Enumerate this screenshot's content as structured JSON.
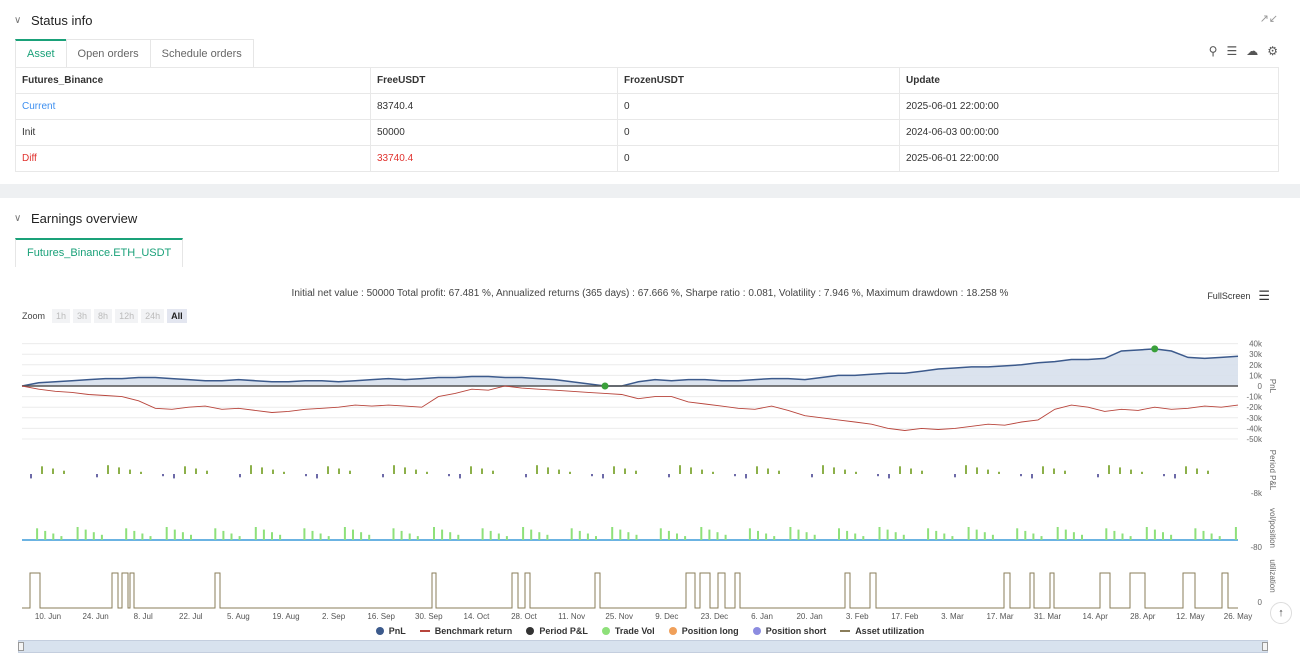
{
  "status": {
    "title": "Status info",
    "tabs": [
      "Asset",
      "Open orders",
      "Schedule orders"
    ],
    "table": {
      "headers": [
        "Futures_Binance",
        "FreeUSDT",
        "FrozenUSDT",
        "Update"
      ],
      "rows": [
        [
          "Current",
          "83740.4",
          "0",
          "2025-06-01 22:00:00"
        ],
        [
          "Init",
          "50000",
          "0",
          "2024-06-03 00:00:00"
        ],
        [
          "Diff",
          "33740.4",
          "0",
          "2025-06-01 22:00:00"
        ]
      ]
    }
  },
  "earnings": {
    "title": "Earnings overview",
    "tab": "Futures_Binance.ETH_USDT",
    "summary": "Initial net value : 50000 Total profit: 67.481 %, Annualized returns (365 days) : 67.666 %, Sharpe ratio : 0.081, Volatility : 7.946 %, Maximum drawdown : 18.258 %",
    "fullscreen": "FullScreen",
    "zoom_label": "Zoom",
    "zoom_options": [
      "1h",
      "3h",
      "8h",
      "12h",
      "24h",
      "All"
    ],
    "zoom_selected": "All"
  },
  "chart_data": {
    "type": "line",
    "x_ticks": [
      "10. Jun",
      "24. Jun",
      "8. Jul",
      "22. Jul",
      "5. Aug",
      "19. Aug",
      "2. Sep",
      "16. Sep",
      "30. Sep",
      "14. Oct",
      "28. Oct",
      "11. Nov",
      "25. Nov",
      "9. Dec",
      "23. Dec",
      "6. Jan",
      "20. Jan",
      "3. Feb",
      "17. Feb",
      "3. Mar",
      "17. Mar",
      "31. Mar",
      "14. Apr",
      "28. Apr",
      "12. May",
      "26. May"
    ],
    "pnl_axis": {
      "label": "PnL",
      "ticks": [
        "40k",
        "30k",
        "20k",
        "10k",
        "0",
        "-10k",
        "-20k",
        "-30k",
        "-40k",
        "-50k"
      ]
    },
    "period_axis": {
      "label": "Period P&L",
      "ticks": [
        "-8k"
      ]
    },
    "vol_axis": {
      "label": "vol/position",
      "ticks": [
        "-80"
      ]
    },
    "util_axis": {
      "label": "utilization",
      "ticks": [
        "0"
      ]
    },
    "series": [
      {
        "name": "PnL",
        "color": "#3c5a8c"
      },
      {
        "name": "Benchmark return",
        "color": "#b8453c"
      },
      {
        "name": "Period P&L",
        "color": "#333333"
      },
      {
        "name": "Trade Vol",
        "color": "#8ee07a"
      },
      {
        "name": "Position long",
        "color": "#f0a05a"
      },
      {
        "name": "Position short",
        "color": "#8c8ce0"
      },
      {
        "name": "Asset utilization",
        "color": "#8a7d5a"
      }
    ],
    "pnl": [
      0,
      3,
      4,
      5,
      6,
      7,
      7,
      8,
      8,
      7,
      6,
      5,
      5,
      6,
      5,
      4,
      4,
      5,
      5,
      4,
      5,
      6,
      7,
      6,
      7,
      8,
      8,
      9,
      9,
      8,
      8,
      7,
      6,
      4,
      2,
      0,
      0,
      4,
      6,
      5,
      6,
      6,
      5,
      5,
      6,
      7,
      7,
      6,
      8,
      10,
      10,
      11,
      12,
      12,
      14,
      16,
      17,
      18,
      18,
      19,
      20,
      22,
      23,
      25,
      25,
      26,
      33,
      34,
      35,
      33,
      27,
      26,
      27,
      28
    ],
    "benchmark": [
      0,
      -3,
      -5,
      -6,
      -8,
      -9,
      -10,
      -14,
      -21,
      -22,
      -20,
      -19,
      -22,
      -21,
      -23,
      -25,
      -24,
      -22,
      -21,
      -20,
      -18,
      -19,
      -18,
      -19,
      -20,
      -10,
      -7,
      -3,
      -4,
      0,
      -2,
      -3,
      -4,
      -5,
      -6,
      -7,
      -8,
      -12,
      -10,
      -10,
      -15,
      -17,
      -19,
      -21,
      -22,
      -19,
      -23,
      -28,
      -30,
      -32,
      -34,
      -36,
      -40,
      -42,
      -40,
      -41,
      -40,
      -38,
      -36,
      -37,
      -34,
      -32,
      -22,
      -18,
      -20,
      -24,
      -22,
      -23,
      -20,
      -22,
      -21,
      -19,
      -20,
      -18
    ],
    "x_range": [
      "2024-06-03",
      "2025-06-01"
    ]
  }
}
